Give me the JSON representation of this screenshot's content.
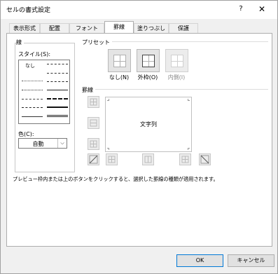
{
  "window": {
    "title": "セルの書式設定",
    "help": "?",
    "close": "✕"
  },
  "tabs": [
    {
      "label": "表示形式"
    },
    {
      "label": "配置"
    },
    {
      "label": "フォント"
    },
    {
      "label": "罫線"
    },
    {
      "label": "塗りつぶし"
    },
    {
      "label": "保護"
    }
  ],
  "active_tab": "罫線",
  "line_section": {
    "title": "線",
    "style_label": "スタイル(S):",
    "none_label": "なし",
    "color_label": "色(C):",
    "color_value": "自動"
  },
  "preset_section": {
    "title": "プリセット",
    "buttons": [
      {
        "label": "なし(N)"
      },
      {
        "label": "外枠(O)"
      },
      {
        "label": "内側(I)"
      }
    ]
  },
  "border_section": {
    "title": "罫線",
    "preview_text": "文字列"
  },
  "note": "プレビュー枠内または上のボタンをクリックすると、選択した罫線の種類が適用されます。",
  "buttons": {
    "ok": "OK",
    "cancel": "キャンセル"
  },
  "colors": {
    "accent": "#0078d7",
    "dialog_bg": "#f0f0f0",
    "panel_bg": "#ffffff"
  }
}
